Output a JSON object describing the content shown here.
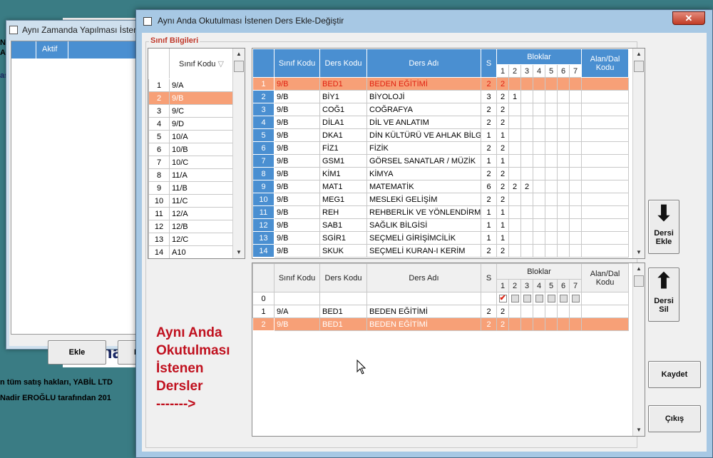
{
  "background": {
    "left_text_1": "N",
    "left_text_2": "A",
    "left_text_3": "as",
    "logo_text": "Sana",
    "footer_line1": "n tüm satış hakları, YABİL LTD",
    "footer_line2": "Nadir EROĞLU tarafından 201"
  },
  "back_window": {
    "title": "Aynı Zamanda Yapılması İsten",
    "grid_header": "Aktif",
    "button_add": "Ekle",
    "button_second": "De"
  },
  "main_window": {
    "title": "Aynı Anda Okutulması İstenen Ders Ekle-Değiştir",
    "close_label": "✕",
    "group_label": "Sınıf Bilgileri",
    "class_grid": {
      "header": "Sınıf Kodu",
      "rows": [
        {
          "n": "1",
          "code": "9/A"
        },
        {
          "n": "2",
          "code": "9/B"
        },
        {
          "n": "3",
          "code": "9/C"
        },
        {
          "n": "4",
          "code": "9/D"
        },
        {
          "n": "5",
          "code": "10/A"
        },
        {
          "n": "6",
          "code": "10/B"
        },
        {
          "n": "7",
          "code": "10/C"
        },
        {
          "n": "8",
          "code": "11/A"
        },
        {
          "n": "9",
          "code": "11/B"
        },
        {
          "n": "10",
          "code": "11/C"
        },
        {
          "n": "11",
          "code": "12/A"
        },
        {
          "n": "12",
          "code": "12/B"
        },
        {
          "n": "13",
          "code": "12/C"
        },
        {
          "n": "14",
          "code": "A10"
        }
      ]
    },
    "lessons_grid": {
      "headers": {
        "class": "Sınıf Kodu",
        "code": "Ders Kodu",
        "name": "Ders Adı",
        "s": "S",
        "blocks": "Bloklar",
        "area": "Alan/Dal Kodu",
        "block_nums": [
          "1",
          "2",
          "3",
          "4",
          "5",
          "6",
          "7"
        ]
      },
      "rows": [
        {
          "n": "1",
          "c": "9/B",
          "k": "BED1",
          "a": "BEDEN EĞİTİMİ",
          "s": "2",
          "b": [
            "2",
            "",
            "",
            "",
            "",
            "",
            ""
          ]
        },
        {
          "n": "2",
          "c": "9/B",
          "k": "BİY1",
          "a": "BİYOLOJİ",
          "s": "3",
          "b": [
            "2",
            "1",
            "",
            "",
            "",
            "",
            ""
          ]
        },
        {
          "n": "3",
          "c": "9/B",
          "k": "COĞ1",
          "a": "COĞRAFYA",
          "s": "2",
          "b": [
            "2",
            "",
            "",
            "",
            "",
            "",
            ""
          ]
        },
        {
          "n": "4",
          "c": "9/B",
          "k": "DİLA1",
          "a": "DİL VE ANLATIM",
          "s": "2",
          "b": [
            "2",
            "",
            "",
            "",
            "",
            "",
            ""
          ]
        },
        {
          "n": "5",
          "c": "9/B",
          "k": "DKA1",
          "a": "DİN KÜLTÜRÜ VE AHLAK BİLGİSİ",
          "s": "1",
          "b": [
            "1",
            "",
            "",
            "",
            "",
            "",
            ""
          ]
        },
        {
          "n": "6",
          "c": "9/B",
          "k": "FİZ1",
          "a": "FİZİK",
          "s": "2",
          "b": [
            "2",
            "",
            "",
            "",
            "",
            "",
            ""
          ]
        },
        {
          "n": "7",
          "c": "9/B",
          "k": "GSM1",
          "a": "GÖRSEL SANATLAR / MÜZİK",
          "s": "1",
          "b": [
            "1",
            "",
            "",
            "",
            "",
            "",
            ""
          ]
        },
        {
          "n": "8",
          "c": "9/B",
          "k": "KİM1",
          "a": "KİMYA",
          "s": "2",
          "b": [
            "2",
            "",
            "",
            "",
            "",
            "",
            ""
          ]
        },
        {
          "n": "9",
          "c": "9/B",
          "k": "MAT1",
          "a": "MATEMATİK",
          "s": "6",
          "b": [
            "2",
            "2",
            "2",
            "",
            "",
            "",
            ""
          ]
        },
        {
          "n": "10",
          "c": "9/B",
          "k": "MEG1",
          "a": "MESLEKİ GELİŞİM",
          "s": "2",
          "b": [
            "2",
            "",
            "",
            "",
            "",
            "",
            ""
          ]
        },
        {
          "n": "11",
          "c": "9/B",
          "k": "REH",
          "a": "REHBERLİK VE YÖNLENDİRME",
          "s": "1",
          "b": [
            "1",
            "",
            "",
            "",
            "",
            "",
            ""
          ]
        },
        {
          "n": "12",
          "c": "9/B",
          "k": "SAB1",
          "a": "SAĞLIK BİLGİSİ",
          "s": "1",
          "b": [
            "1",
            "",
            "",
            "",
            "",
            "",
            ""
          ]
        },
        {
          "n": "13",
          "c": "9/B",
          "k": "SGİR1",
          "a": "SEÇMELİ GİRİŞİMCİLİK",
          "s": "1",
          "b": [
            "1",
            "",
            "",
            "",
            "",
            "",
            ""
          ]
        },
        {
          "n": "14",
          "c": "9/B",
          "k": "SKUK",
          "a": "SEÇMELİ KURAN-I KERİM",
          "s": "2",
          "b": [
            "2",
            "",
            "",
            "",
            "",
            "",
            ""
          ]
        }
      ]
    },
    "selected_grid": {
      "rows": [
        {
          "n": "1",
          "c": "9/A",
          "k": "BED1",
          "a": "BEDEN EĞİTİMİ",
          "s": "2",
          "b": [
            "2",
            "",
            "",
            "",
            "",
            "",
            ""
          ]
        },
        {
          "n": "2",
          "c": "9/B",
          "k": "BED1",
          "a": "BEDEN EĞİTİMİ",
          "s": "2",
          "b": [
            "2",
            "",
            "",
            "",
            "",
            "",
            ""
          ]
        }
      ],
      "row0_label": "0",
      "checkmark": "✔"
    },
    "buttons": {
      "add_lesson": "Dersi Ekle",
      "remove_lesson": "Dersi Sil",
      "save": "Kaydet",
      "exit": "Çıkış"
    },
    "info_text": [
      "Aynı Anda",
      "Okutulması",
      "İstenen",
      "Dersler",
      "------->"
    ],
    "colors": {
      "header_blue": "#4a8fd1",
      "selected_row": "#f7a077",
      "accent_red": "#c0101e"
    }
  }
}
